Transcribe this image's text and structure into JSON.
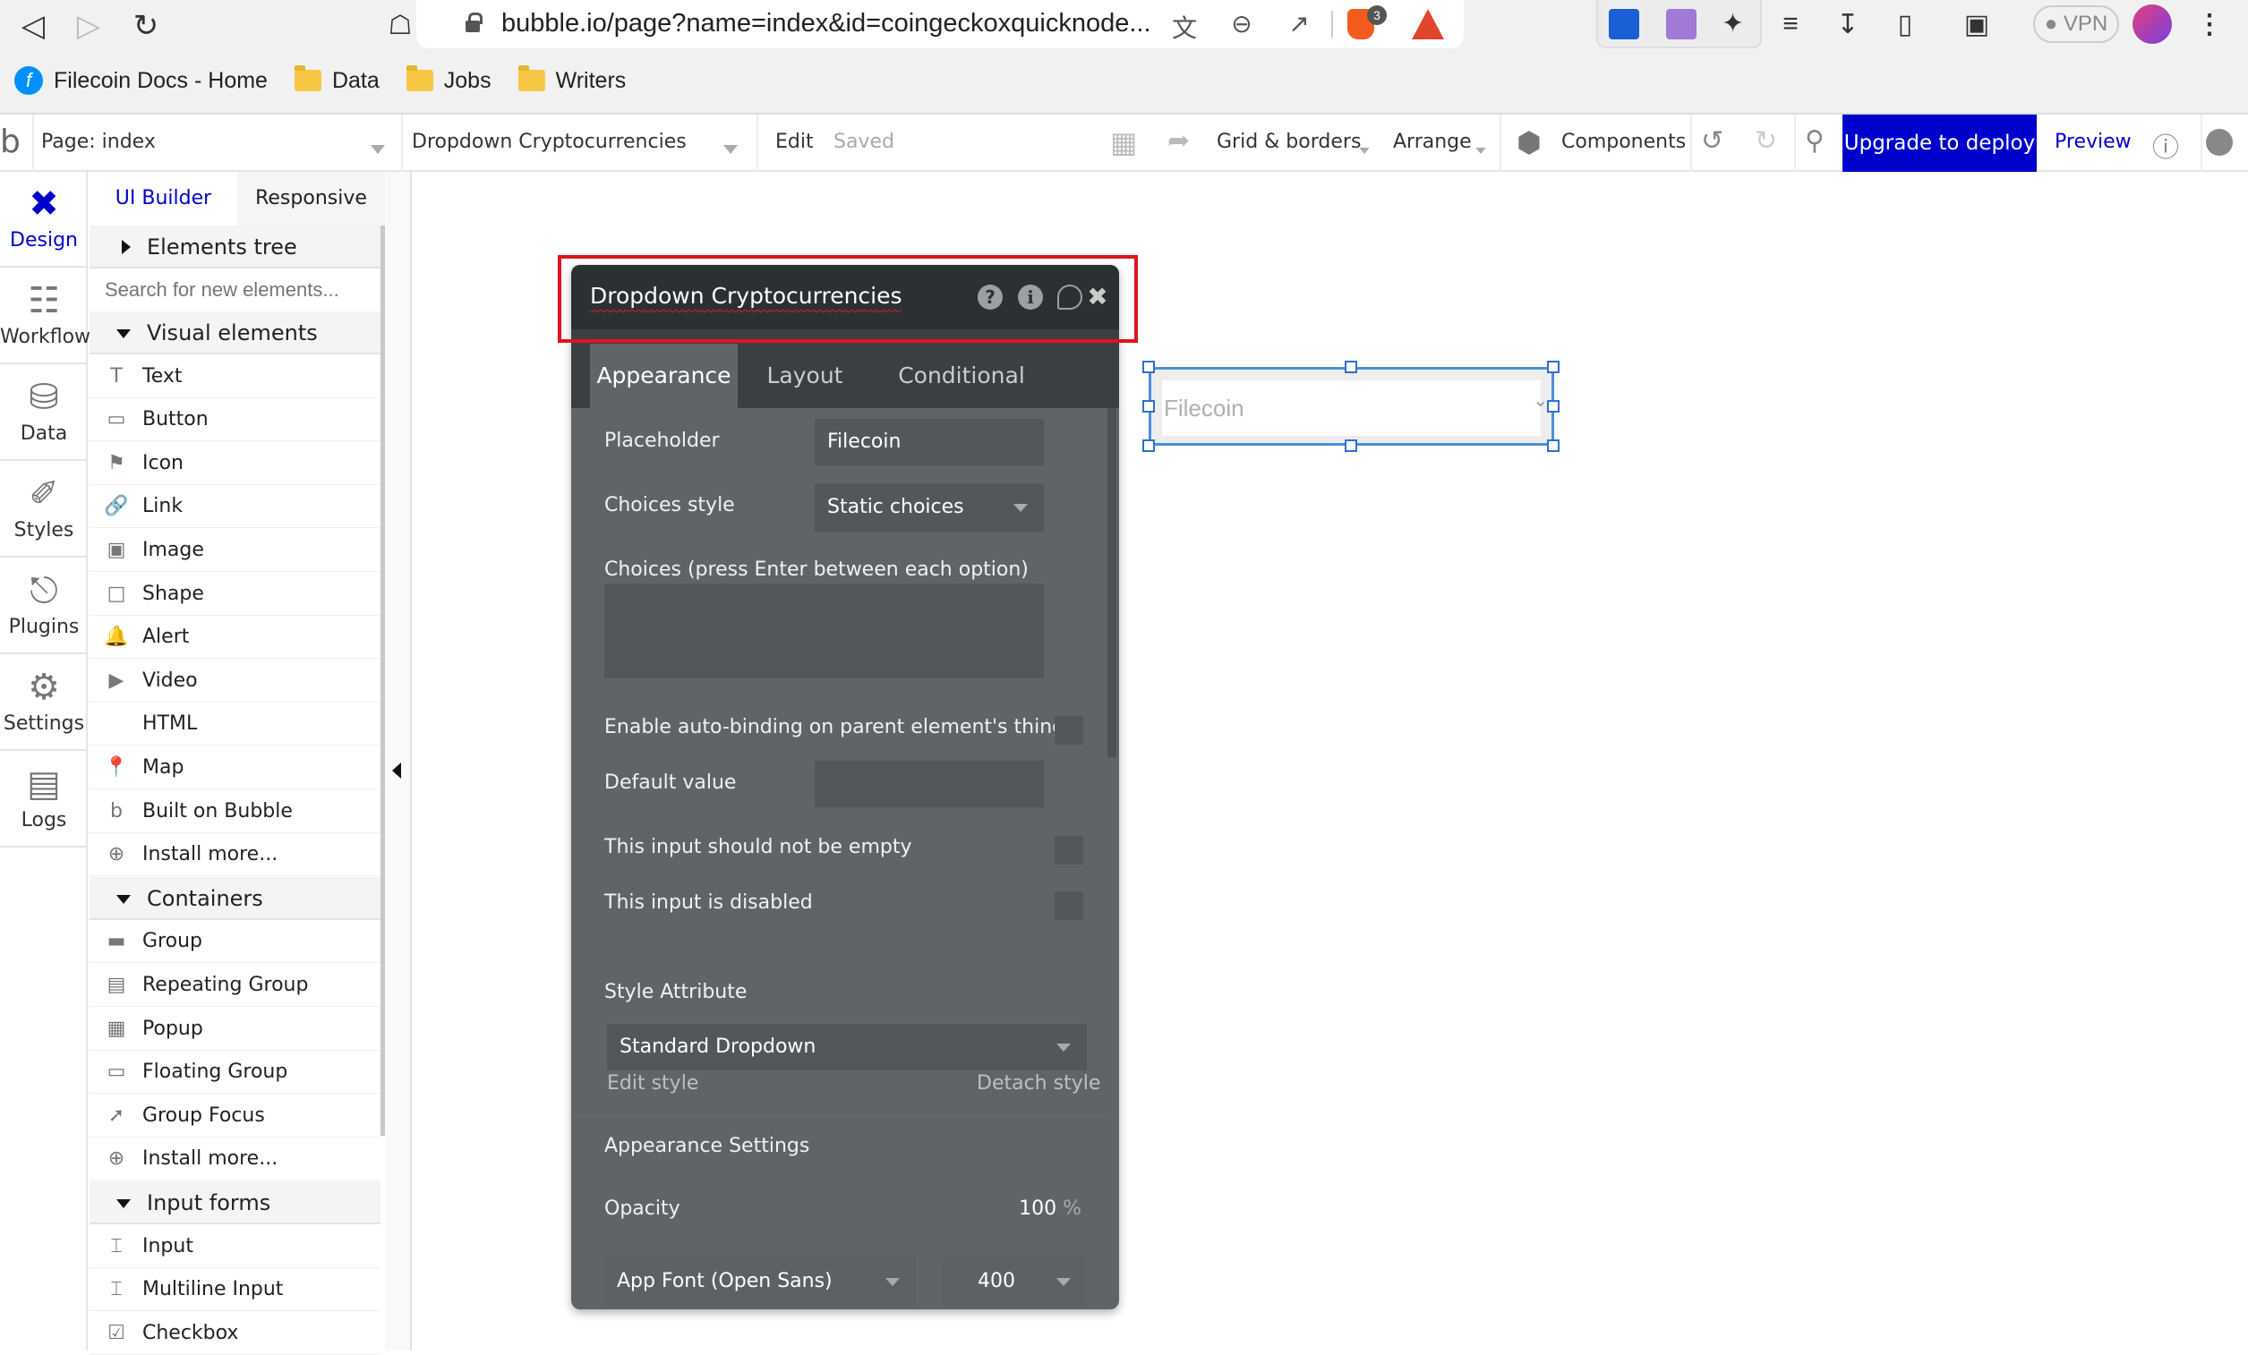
{
  "browser": {
    "url": "bubble.io/page?name=index&id=coingeckoxquicknode...",
    "brave_badge": "3",
    "vpn_label": "VPN",
    "bookmarks": [
      {
        "label": "Filecoin Docs - Home",
        "icon": "filecoin-icon"
      },
      {
        "label": "Data",
        "icon": "folder-icon"
      },
      {
        "label": "Jobs",
        "icon": "folder-icon"
      },
      {
        "label": "Writers",
        "icon": "folder-icon"
      }
    ]
  },
  "header": {
    "logo": "b",
    "page_label": "Page: index",
    "element_selector": "Dropdown Cryptocurrencies",
    "edit_label": "Edit",
    "saved_label": "Saved",
    "grid_label": "Grid & borders",
    "arrange_label": "Arrange",
    "components_label": "Components",
    "upgrade_label": "Upgrade to deploy",
    "preview_label": "Preview",
    "upgrade_color": "#0000cc"
  },
  "rail": [
    {
      "label": "Design",
      "icon": "design-icon",
      "active": true
    },
    {
      "label": "Workflow",
      "icon": "workflow-icon"
    },
    {
      "label": "Data",
      "icon": "database-icon"
    },
    {
      "label": "Styles",
      "icon": "brush-icon"
    },
    {
      "label": "Plugins",
      "icon": "plugin-icon"
    },
    {
      "label": "Settings",
      "icon": "gear-icon"
    },
    {
      "label": "Logs",
      "icon": "document-icon"
    }
  ],
  "panel": {
    "tabs": [
      "UI Builder",
      "Responsive"
    ],
    "elements_tree": "Elements tree",
    "search_placeholder": "Search for new elements...",
    "sections": [
      {
        "title": "Visual elements",
        "items": [
          "Text",
          "Button",
          "Icon",
          "Link",
          "Image",
          "Shape",
          "Alert",
          "Video",
          "HTML",
          "Map",
          "Built on Bubble",
          "Install more..."
        ]
      },
      {
        "title": "Containers",
        "items": [
          "Group",
          "Repeating Group",
          "Popup",
          "Floating Group",
          "Group Focus",
          "Install more..."
        ]
      },
      {
        "title": "Input forms",
        "items": [
          "Input",
          "Multiline Input",
          "Checkbox"
        ]
      }
    ]
  },
  "property_editor": {
    "title": "Dropdown Cryptocurrencies",
    "tabs": [
      "Appearance",
      "Layout",
      "Conditional"
    ],
    "active_tab": "Appearance",
    "placeholder_label": "Placeholder",
    "placeholder_value": "Filecoin",
    "choices_style_label": "Choices style",
    "choices_style_value": "Static choices",
    "choices_label": "Choices (press Enter between each option)",
    "choices_value": "",
    "auto_binding_label": "Enable auto-binding on parent element's thing",
    "auto_binding_checked": false,
    "default_value_label": "Default value",
    "default_value": "",
    "not_empty_label": "This input should not be empty",
    "not_empty_checked": false,
    "disabled_label": "This input is disabled",
    "disabled_checked": false,
    "style_attribute_label": "Style Attribute",
    "style_value": "Standard Dropdown",
    "edit_style": "Edit style",
    "detach_style": "Detach style",
    "appearance_settings_label": "Appearance Settings",
    "opacity_label": "Opacity",
    "opacity_value": "100",
    "opacity_unit": "%",
    "font_value": "App Font (Open Sans)",
    "font_weight": "400"
  },
  "canvas": {
    "dropdown_placeholder": "Filecoin"
  }
}
